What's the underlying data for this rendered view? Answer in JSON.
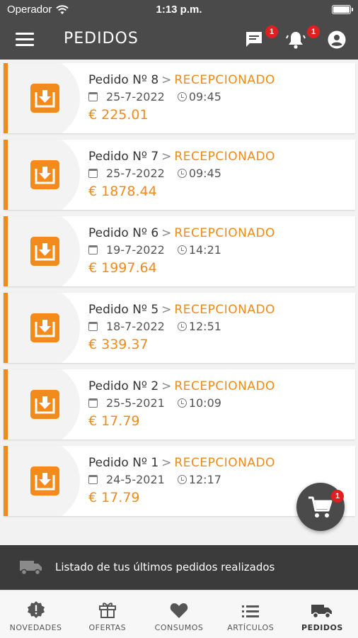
{
  "status_bar": {
    "carrier": "Operador",
    "time": "1:13 p.m."
  },
  "header": {
    "title": "PEDIDOS",
    "messages_badge": "1",
    "notifications_badge": "1"
  },
  "orders": [
    {
      "label": "Pedido Nº 8",
      "status": "RECEPCIONADO",
      "date": "25-7-2022",
      "time": "09:45",
      "amount": "€ 225.01"
    },
    {
      "label": "Pedido Nº 7",
      "status": "RECEPCIONADO",
      "date": "25-7-2022",
      "time": "09:45",
      "amount": "€ 1878.44"
    },
    {
      "label": "Pedido Nº 6",
      "status": "RECEPCIONADO",
      "date": "19-7-2022",
      "time": "14:21",
      "amount": "€ 1997.64"
    },
    {
      "label": "Pedido Nº 5",
      "status": "RECEPCIONADO",
      "date": "18-7-2022",
      "time": "12:51",
      "amount": "€ 339.37"
    },
    {
      "label": "Pedido Nº 2",
      "status": "RECEPCIONADO",
      "date": "25-5-2021",
      "time": "10:09",
      "amount": "€ 17.79"
    },
    {
      "label": "Pedido Nº 1",
      "status": "RECEPCIONADO",
      "date": "24-5-2021",
      "time": "12:17",
      "amount": "€ 17.79"
    }
  ],
  "cart": {
    "badge": "1"
  },
  "info_bar": {
    "text": "Listado de tus últimos pedidos realizados"
  },
  "bottom_nav": {
    "items": [
      {
        "label": "NOVEDADES",
        "icon": "alert-badge-icon"
      },
      {
        "label": "OFERTAS",
        "icon": "gift-icon"
      },
      {
        "label": "CONSUMOS",
        "icon": "heart-icon"
      },
      {
        "label": "ARTÍCULOS",
        "icon": "list-icon"
      },
      {
        "label": "PEDIDOS",
        "icon": "truck-icon"
      }
    ]
  },
  "colors": {
    "accent": "#ef8a1d",
    "header": "#4a4a4a",
    "badge": "#e02020"
  }
}
